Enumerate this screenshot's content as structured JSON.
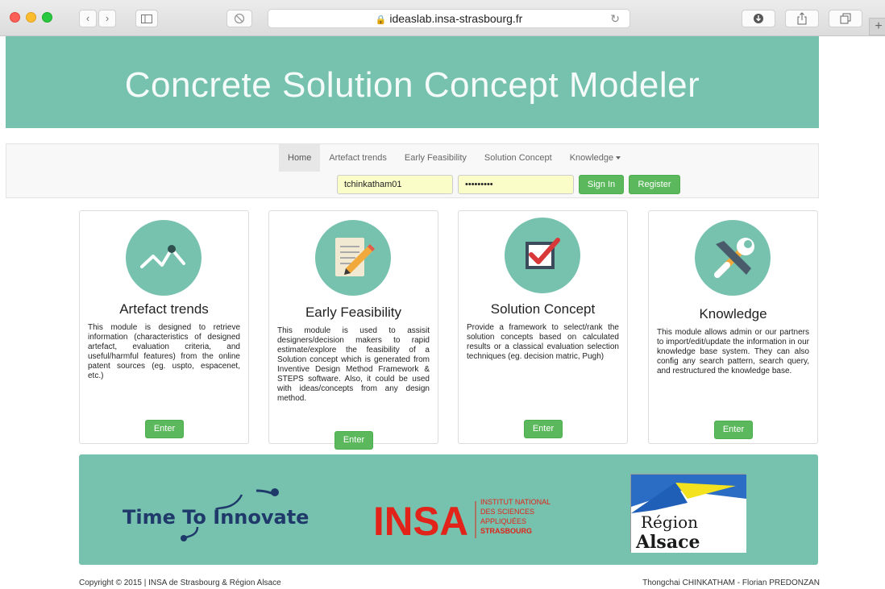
{
  "browser": {
    "url": "ideaslab.insa-strasbourg.fr"
  },
  "header": {
    "title": "Concrete Solution Concept Modeler"
  },
  "nav": {
    "items": [
      {
        "label": "Home"
      },
      {
        "label": "Artefact trends"
      },
      {
        "label": "Early Feasibility"
      },
      {
        "label": "Solution Concept"
      },
      {
        "label": "Knowledge"
      }
    ]
  },
  "login": {
    "username": "tchinkatham01",
    "password": "•••••••••",
    "signin_label": "Sign In",
    "register_label": "Register"
  },
  "cards": [
    {
      "title": "Artefact trends",
      "text": "This module is designed to retrieve information (characteristics of designed artefact, evaluation criteria, and useful/harmful features) from the online patent sources (eg. uspto, espacenet, etc.)",
      "button": "Enter",
      "icon": "trend-line-icon"
    },
    {
      "title": "Early Feasibility",
      "text": "This module is used to assisit designers/decision makers to rapid estimate/explore the feasibility of a Solution concept which is generated from Inventive Design Method Framework & STEPS software. Also, it could be used with ideas/concepts from any design method.",
      "button": "Enter",
      "icon": "notepad-pencil-icon"
    },
    {
      "title": "Solution Concept",
      "text": "Provide a framework to select/rank the solution concepts based on calculated results or a classical evaluation selection techniques (eg. decision matric, Pugh)",
      "button": "Enter",
      "icon": "checkbox-icon"
    },
    {
      "title": "Knowledge",
      "text": "This module allows admin or our partners to import/edit/update the information in our knowledge base system. They can also config any search pattern, search query, and restructured the knowledge base.",
      "button": "Enter",
      "icon": "tools-icon"
    }
  ],
  "partners": {
    "tti": "Time To Innovate",
    "insa_big": "INSA",
    "insa_lines": [
      "INSTITUT NATIONAL",
      "DES SCIENCES",
      "APPLIQUÉES",
      "STRASBOURG"
    ],
    "region_top": "Région",
    "region_bottom": "Alsace"
  },
  "footer": {
    "copyright": "Copyright © 2015 | INSA de Strasbourg & Région Alsace",
    "authors": "Thongchai CHINKATHAM - Florian PREDONZAN"
  },
  "colors": {
    "accent": "#76c2ae",
    "button": "#5cb85c"
  }
}
